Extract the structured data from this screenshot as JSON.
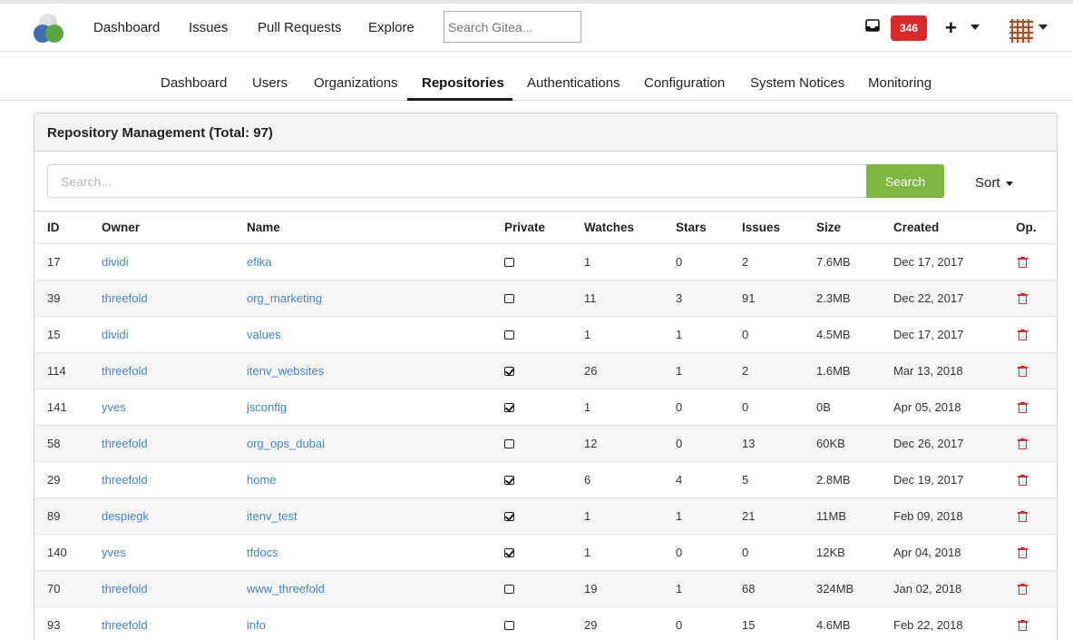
{
  "topnav": {
    "links": [
      "Dashboard",
      "Issues",
      "Pull Requests",
      "Explore"
    ],
    "search_placeholder": "Search Gitea...",
    "notification_count": "346",
    "icons": [
      "inbox-icon",
      "plus-icon",
      "avatar"
    ]
  },
  "admin_tabs": {
    "items": [
      "Dashboard",
      "Users",
      "Organizations",
      "Repositories",
      "Authentications",
      "Configuration",
      "System Notices",
      "Monitoring"
    ],
    "active": "Repositories"
  },
  "panel": {
    "title": "Repository Management (Total: 97)",
    "search_placeholder": "Search...",
    "search_button": "Search",
    "sort_label": "Sort"
  },
  "table": {
    "headers": [
      "ID",
      "Owner",
      "Name",
      "Private",
      "Watches",
      "Stars",
      "Issues",
      "Size",
      "Created",
      "Op."
    ],
    "rows": [
      {
        "id": "17",
        "owner": "dividi",
        "name": "efika",
        "private": false,
        "watches": "1",
        "stars": "0",
        "issues": "2",
        "size": "7.6MB",
        "created": "Dec 17, 2017"
      },
      {
        "id": "39",
        "owner": "threefold",
        "name": "org_marketing",
        "private": false,
        "watches": "11",
        "stars": "3",
        "issues": "91",
        "size": "2.3MB",
        "created": "Dec 22, 2017"
      },
      {
        "id": "15",
        "owner": "dividi",
        "name": "values",
        "private": false,
        "watches": "1",
        "stars": "1",
        "issues": "0",
        "size": "4.5MB",
        "created": "Dec 17, 2017"
      },
      {
        "id": "114",
        "owner": "threefold",
        "name": "itenv_websites",
        "private": true,
        "watches": "26",
        "stars": "1",
        "issues": "2",
        "size": "1.6MB",
        "created": "Mar 13, 2018"
      },
      {
        "id": "141",
        "owner": "yves",
        "name": "jsconfig",
        "private": true,
        "watches": "1",
        "stars": "0",
        "issues": "0",
        "size": "0B",
        "created": "Apr 05, 2018"
      },
      {
        "id": "58",
        "owner": "threefold",
        "name": "org_ops_dubai",
        "private": false,
        "watches": "12",
        "stars": "0",
        "issues": "13",
        "size": "60KB",
        "created": "Dec 26, 2017"
      },
      {
        "id": "29",
        "owner": "threefold",
        "name": "home",
        "private": true,
        "watches": "6",
        "stars": "4",
        "issues": "5",
        "size": "2.8MB",
        "created": "Dec 19, 2017"
      },
      {
        "id": "89",
        "owner": "despiegk",
        "name": "itenv_test",
        "private": true,
        "watches": "1",
        "stars": "1",
        "issues": "21",
        "size": "11MB",
        "created": "Feb 09, 2018"
      },
      {
        "id": "140",
        "owner": "yves",
        "name": "tfdocs",
        "private": true,
        "watches": "1",
        "stars": "0",
        "issues": "0",
        "size": "12KB",
        "created": "Apr 04, 2018"
      },
      {
        "id": "70",
        "owner": "threefold",
        "name": "www_threefold",
        "private": false,
        "watches": "19",
        "stars": "1",
        "issues": "68",
        "size": "324MB",
        "created": "Jan 02, 2018"
      },
      {
        "id": "93",
        "owner": "threefold",
        "name": "info",
        "private": false,
        "watches": "29",
        "stars": "0",
        "issues": "15",
        "size": "4.6MB",
        "created": "Feb 22, 2018"
      }
    ]
  },
  "colors": {
    "accent_link": "#4183c4",
    "search_button": "#7db640",
    "badge": "#db2828",
    "delete": "#db2828"
  }
}
